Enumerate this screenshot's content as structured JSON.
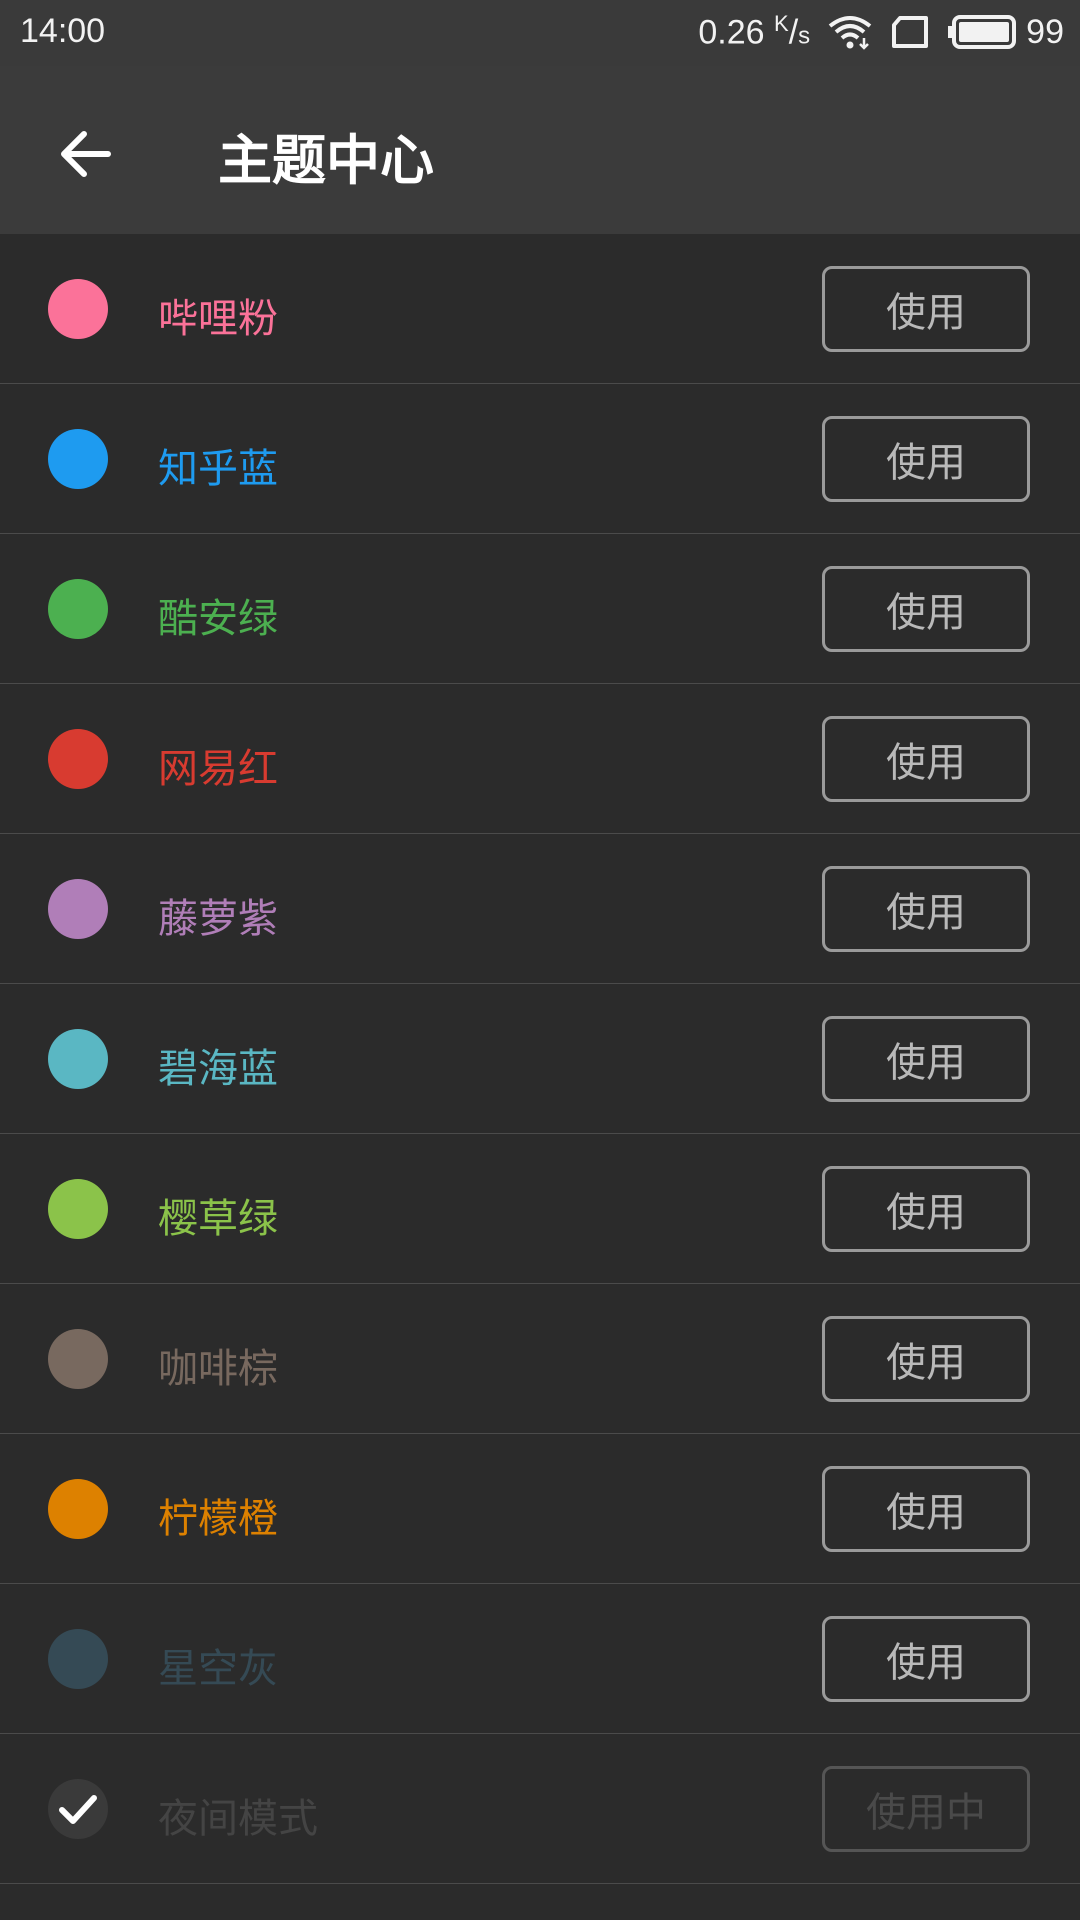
{
  "status_bar": {
    "time": "14:00",
    "net_speed": "0.26",
    "net_unit_k": "K",
    "net_unit_s": "s",
    "battery": "99",
    "icons": [
      "wifi-icon",
      "sim-card-icon",
      "battery-icon"
    ]
  },
  "app_bar": {
    "title": "主题中心",
    "back_icon": "arrow-left-icon"
  },
  "themes": [
    {
      "name": "哔哩粉",
      "color": "#fb7299",
      "button": "使用"
    },
    {
      "name": "知乎蓝",
      "color": "#1e9bf0",
      "button": "使用"
    },
    {
      "name": "酷安绿",
      "color": "#4cb050",
      "button": "使用"
    },
    {
      "name": "网易红",
      "color": "#d83b30",
      "button": "使用"
    },
    {
      "name": "藤萝紫",
      "color": "#b07eb8",
      "button": "使用"
    },
    {
      "name": "碧海蓝",
      "color": "#5ab7c3",
      "button": "使用"
    },
    {
      "name": "樱草绿",
      "color": "#8bc34a",
      "button": "使用"
    },
    {
      "name": "咖啡棕",
      "color": "#78695f",
      "button": "使用"
    },
    {
      "name": "柠檬橙",
      "color": "#dd8100",
      "button": "使用"
    },
    {
      "name": "星空灰",
      "color": "#354a55",
      "button": "使用"
    },
    {
      "name": "夜间模式",
      "color": "#3a3a3a",
      "button": "使用中",
      "selected": true,
      "icon": "checkmark-icon"
    }
  ]
}
